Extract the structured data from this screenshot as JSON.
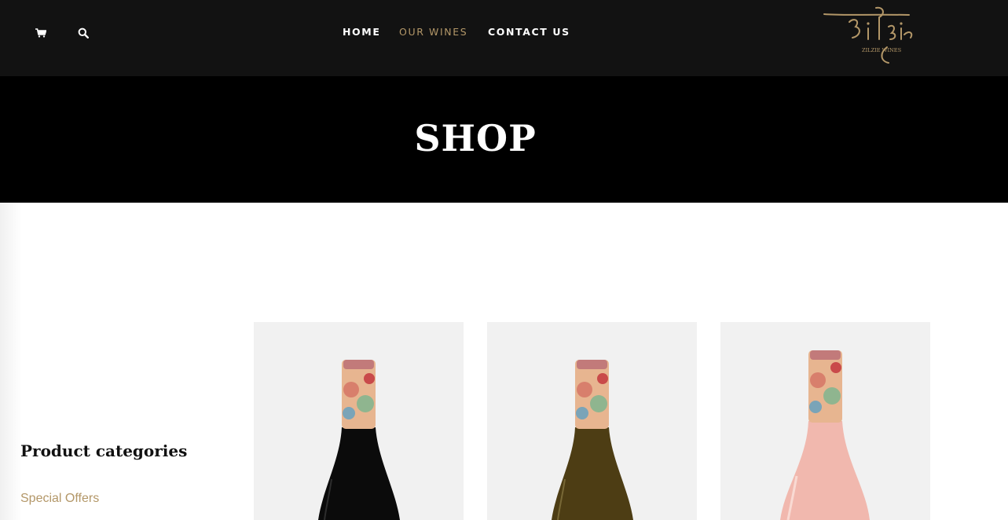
{
  "header": {
    "icons": [
      "cart-icon",
      "search-icon"
    ],
    "nav": [
      {
        "label": "HOME",
        "active": false
      },
      {
        "label": "OUR WINES",
        "active": true
      },
      {
        "label": "CONTACT US",
        "active": false
      }
    ],
    "logo": {
      "script_text": "Zilzie",
      "caption": "ZILZIE WINES"
    }
  },
  "hero": {
    "title": "SHOP"
  },
  "sidebar": {
    "heading": "Product categories",
    "categories": [
      "Special Offers"
    ]
  },
  "products": [
    {
      "wine_color": "#0b0b0b"
    },
    {
      "wine_color": "#4d3d14"
    },
    {
      "wine_color": "#f1b8ae"
    }
  ],
  "colors": {
    "header_bg": "#121212",
    "hero_bg": "#000000",
    "accent": "#b39768",
    "card_bg": "#f1f1f1"
  }
}
